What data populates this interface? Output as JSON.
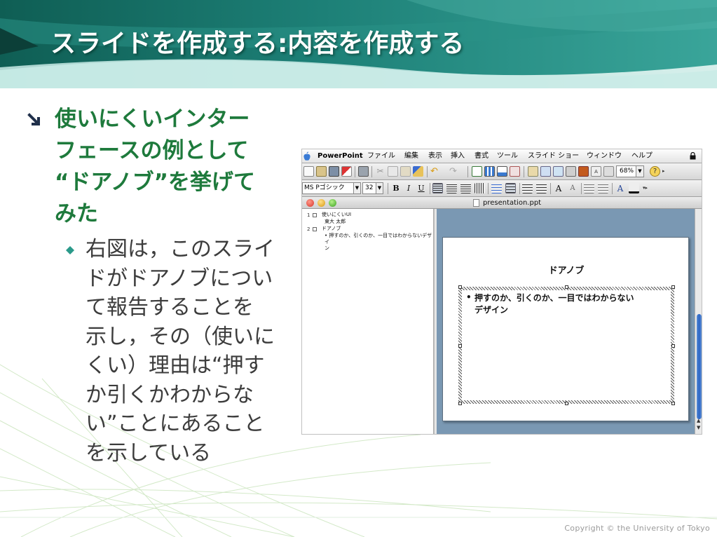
{
  "slide": {
    "title": "スライドを作成する:内容を作成する",
    "bullet1": "使いにくいインター\nフェースの例として\n“ドアノブ”を挙げて\nみた",
    "bullet2": "右図は，このスライ\nドがドアノブについ\nて報告することを\n示し，その（使いに\nくい）理由は“押す\nか引くかわからな\nい”ことにあること\nを示している",
    "copyright": "Copyright © the University of Tokyo",
    "colors": {
      "title_band": "#1b7a72",
      "heading_green": "#1e7a3c",
      "body_text": "#3c3c3c",
      "bullet_teal": "#2a9a8a"
    }
  },
  "app": {
    "menubar": {
      "app_name": "PowerPoint",
      "items": [
        "ファイル",
        "編集",
        "表示",
        "挿入",
        "書式",
        "ツール",
        "スライド ショー",
        "ウィンドウ",
        "ヘルプ"
      ]
    },
    "toolbar": {
      "zoom": "68%",
      "font_name": "MS Pゴシック",
      "font_size": "32",
      "bold": "B",
      "italic": "I",
      "underline": "U"
    },
    "window_title": "presentation.ppt",
    "outline": [
      {
        "num": "1",
        "title": "使いにくいUI",
        "sub": "東大 太郎"
      },
      {
        "num": "2",
        "title": "ドアノブ",
        "sub": "• 押すのか、引くのか、一目ではわからないデザイ\nン"
      }
    ],
    "mini_slide": {
      "title": "ドアノブ",
      "bullet": "•",
      "body": "押すのか、引くのか、一目ではわからない\nデザイン"
    }
  }
}
